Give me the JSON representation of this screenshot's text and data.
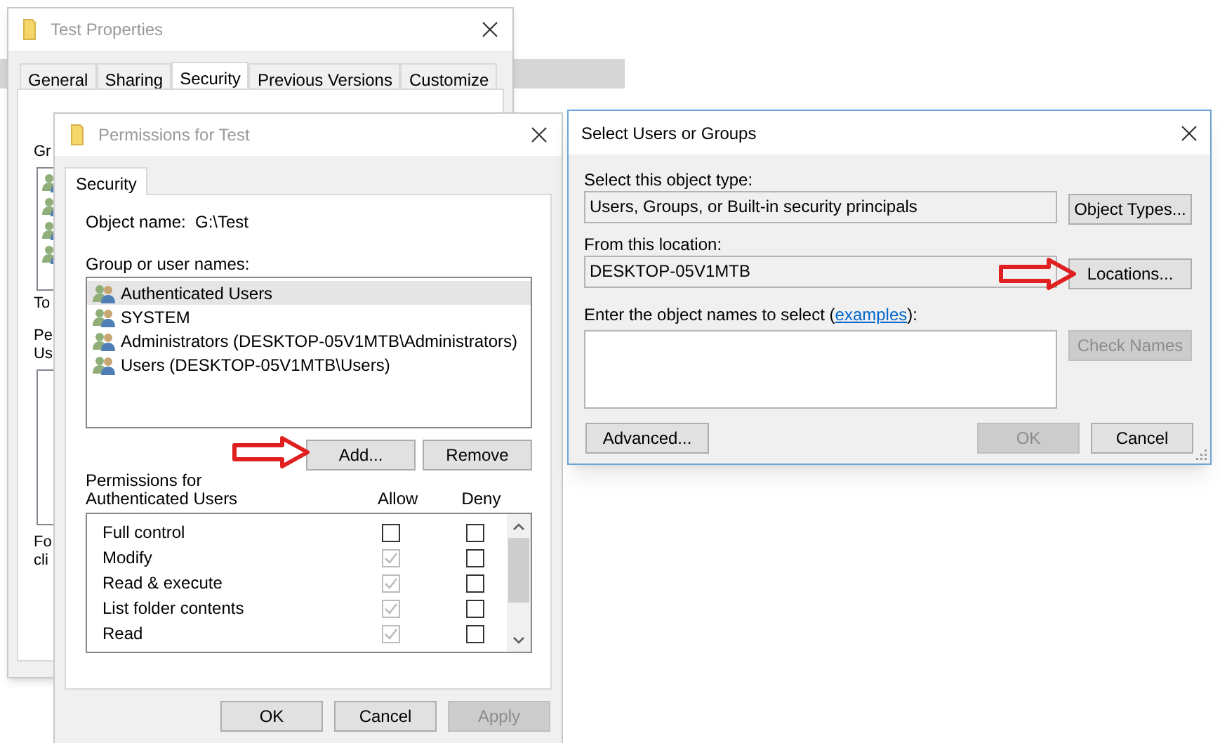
{
  "properties_window": {
    "title": "Test Properties",
    "tabs": [
      {
        "label": "General",
        "selected": false
      },
      {
        "label": "Sharing",
        "selected": false
      },
      {
        "label": "Security",
        "selected": true
      },
      {
        "label": "Previous Versions",
        "selected": false
      },
      {
        "label": "Customize",
        "selected": false
      }
    ],
    "cut_labels": [
      "Gr",
      "To",
      "Pe",
      "Us",
      "Fo",
      "cli"
    ]
  },
  "permissions_window": {
    "title": "Permissions for Test",
    "tabs": [
      {
        "label": "Security",
        "selected": true
      }
    ],
    "object_name_label": "Object name:",
    "object_name": "G:\\Test",
    "group_label": "Group or user names:",
    "principals": [
      {
        "name": "Authenticated Users",
        "selected": true
      },
      {
        "name": "SYSTEM",
        "selected": false
      },
      {
        "name": "Administrators (DESKTOP-05V1MTB\\Administrators)",
        "selected": false
      },
      {
        "name": "Users (DESKTOP-05V1MTB\\Users)",
        "selected": false
      }
    ],
    "list_buttons": [
      "Add...",
      "Remove"
    ],
    "permissions_label": "Permissions for Authenticated Users",
    "columns": [
      "Allow",
      "Deny"
    ],
    "permissions": [
      {
        "name": "Full control",
        "allow": false,
        "allow_disabled": false,
        "deny": false
      },
      {
        "name": "Modify",
        "allow": true,
        "allow_disabled": true,
        "deny": false
      },
      {
        "name": "Read & execute",
        "allow": true,
        "allow_disabled": true,
        "deny": false
      },
      {
        "name": "List folder contents",
        "allow": true,
        "allow_disabled": true,
        "deny": false
      },
      {
        "name": "Read",
        "allow": true,
        "allow_disabled": true,
        "deny": false
      }
    ],
    "footer_buttons": [
      {
        "label": "OK",
        "disabled": false
      },
      {
        "label": "Cancel",
        "disabled": false
      },
      {
        "label": "Apply",
        "disabled": true
      }
    ]
  },
  "select_window": {
    "title": "Select Users or Groups",
    "object_type_label": "Select this object type:",
    "object_type": "Users, Groups, or Built-in security principals",
    "object_types_button": "Object Types...",
    "location_label": "From this location:",
    "location": "DESKTOP-05V1MTB",
    "locations_button": "Locations...",
    "names_label_before": "Enter the object names to select (",
    "names_link": "examples",
    "names_label_after": "):",
    "check_names_button": {
      "label": "Check Names",
      "disabled": true
    },
    "advanced_button": "Advanced...",
    "footer_buttons": [
      {
        "label": "OK",
        "disabled": true
      },
      {
        "label": "Cancel",
        "disabled": false
      }
    ]
  }
}
